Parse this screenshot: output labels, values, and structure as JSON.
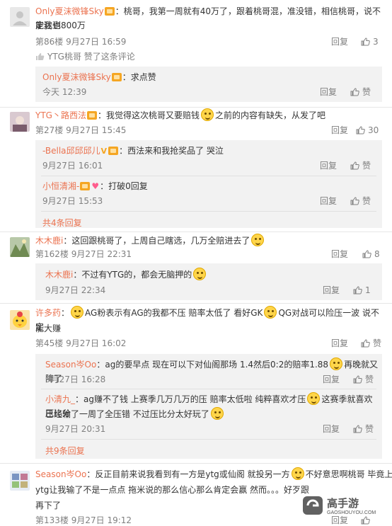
{
  "comments": [
    {
      "name": "Only夏沫微锋Sky",
      "text_a": "：桃哥，我第一周就有40万了，跟着桃哥混，准没错，相信桃哥，说不定我也",
      "text_b": "能达到800万",
      "meta": "第86楼 9月27日 16:59",
      "reply": "回复",
      "likes": "3",
      "liked_by": "YTG桃哥 赞了这条评论",
      "replies": [
        {
          "name": "Only夏沫微锋Sky",
          "text": "：求点赞",
          "time": "今天 12:39",
          "reply": "回复",
          "like": "赞"
        }
      ]
    },
    {
      "name": "YTG丶路西法",
      "text_a": "：我觉得这次桃哥又要赔钱",
      "text_b": "之前的内容有缺失，从发了吧",
      "meta": "第27楼 9月27日 15:45",
      "reply": "回复",
      "likes": "30",
      "replies": [
        {
          "name": "-Bella邱邱邱儿",
          "text": "：西法来和我抢奖品了 哭泣",
          "time": "9月27日 16:01",
          "reply": "回复",
          "like": "赞"
        },
        {
          "name": "小恒清湘-",
          "text": "：打破0回复",
          "time": "9月27日 15:53",
          "reply": "回复",
          "like": "赞"
        }
      ],
      "more": "共4条回复"
    },
    {
      "name": "木木鹿i",
      "text_a": "：这回跟桃哥了，上周自己瞎选，几万全赔进去了",
      "meta": "第162楼 9月27日 22:31",
      "reply": "回复",
      "likes": "8",
      "replies": [
        {
          "name": "木木鹿i",
          "text": "：不过有YTG的，都会无脑押的",
          "time": "9月27日 22:34",
          "reply": "回复",
          "like": "1"
        }
      ]
    },
    {
      "name": "许多药",
      "text_a": "AG粉表示有AG的我都不压 赔率太低了 看好GK",
      "text_a2": "QG对战可以险压一波 说不定",
      "text_b": "能大赚",
      "meta": "第45楼 9月27日 16:02",
      "reply": "回复",
      "like": "赞",
      "replies": [
        {
          "name": "Season岑Oo",
          "text": "：ag的要早点 现在可以下对仙阁那场 1.4然后0:2的赔率1.88",
          "text2": "再晚就又降了",
          "time": "9月27日 16:28",
          "reply": "回复",
          "like": "赞"
        },
        {
          "name": "小清九_",
          "text": "：ag赚不了钱 上赛季几万几万的压 赔率太低啦 纯粹喜欢才压",
          "text2": "这赛季就喜欢压比分",
          "text3": "已经输了一周了全压错 不过压比分太好玩了",
          "time": "9月27日 20:31",
          "reply": "回复",
          "like": "赞"
        }
      ],
      "more": "共9条回复"
    },
    {
      "name": "Season岑Oo",
      "text_a": "：反正目前来说我看到有一方是ytg或仙阁 就投另一方",
      "text_a2": "不好意思啊桃哥 毕竟上周",
      "text_b": "ytg让我输了不是一点点 拖米说的那么信心那么肯定会赢 然而。。。好歹跟",
      "text_c": "再下了",
      "meta": "第133楼 9月27日 19:12",
      "reply": "回复",
      "likes": ""
    }
  ],
  "watermark": {
    "brand": "高手游",
    "url": "GAOSHOUYOU.COM"
  },
  "colors": {
    "name": "#eb7350",
    "meta": "#808080",
    "reply_bg": "#f2f2f2",
    "text": "#333333"
  }
}
